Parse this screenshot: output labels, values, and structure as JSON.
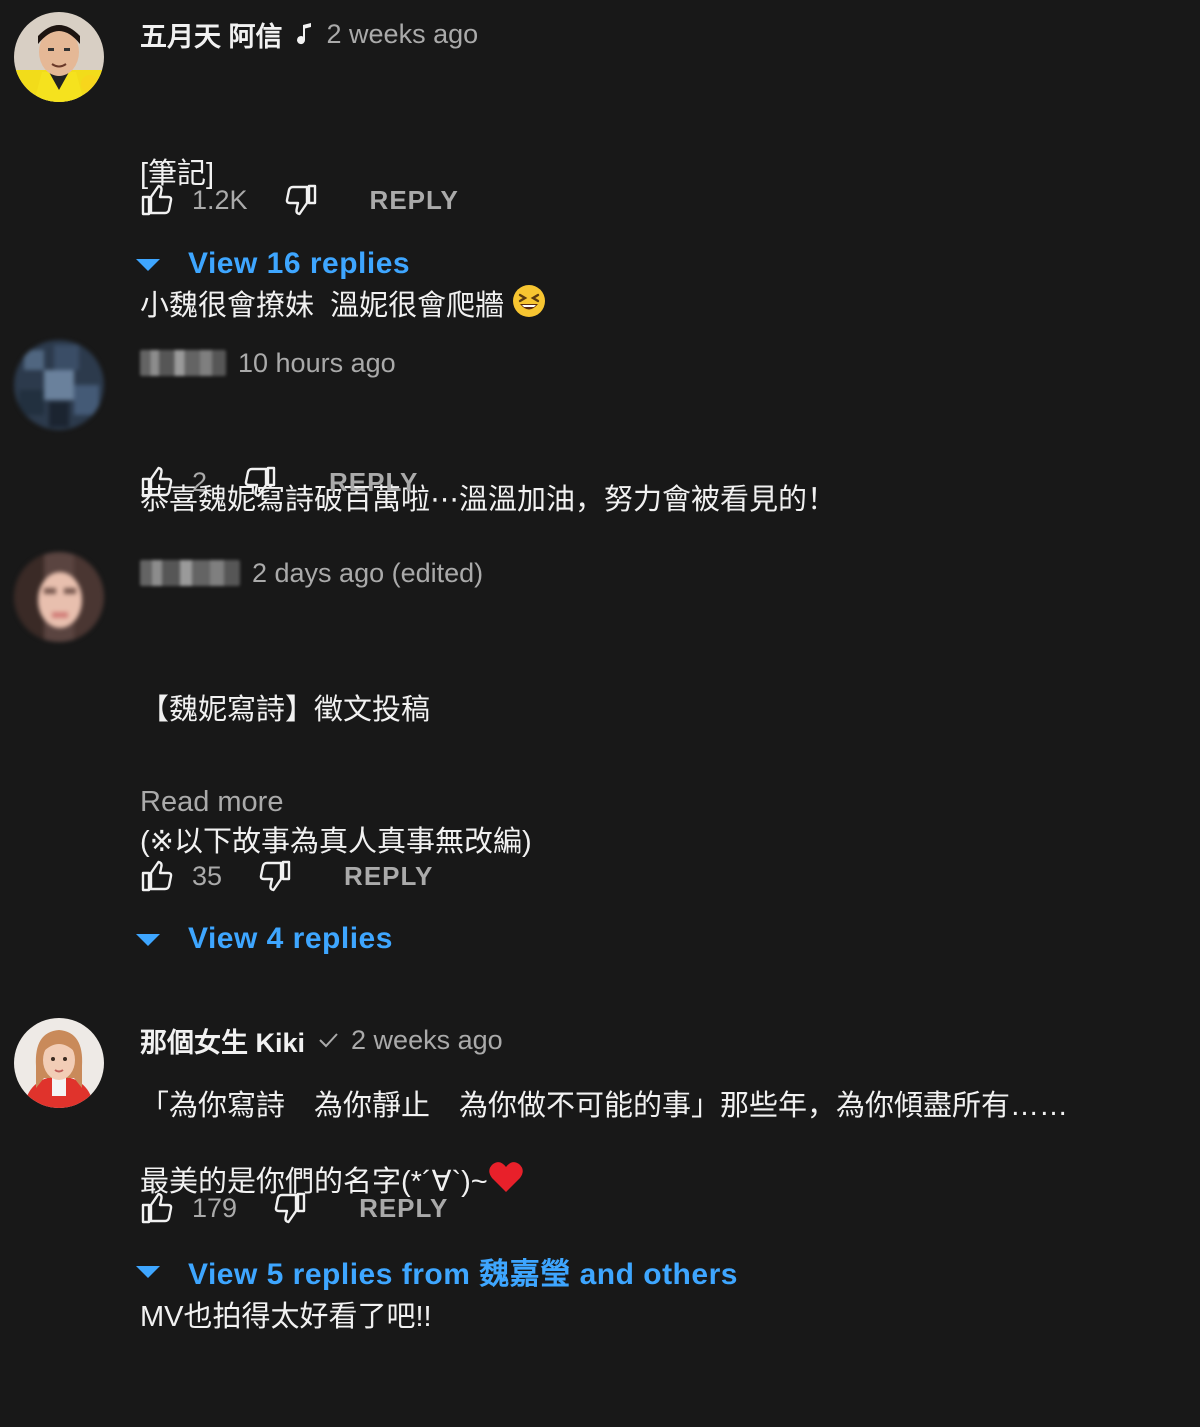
{
  "comments": [
    {
      "author": "五月天 阿信",
      "badge_icon": "music-note-icon",
      "timestamp": "2 weeks ago",
      "body_lines": [
        "[筆記]",
        "小魏很會撩妹  溫妮很會爬牆"
      ],
      "body_emoji": "grinning-squinting-face-emoji",
      "likes": "1.2K",
      "reply_label": "REPLY",
      "view_replies": "View 16 replies"
    },
    {
      "author_blurred": true,
      "timestamp": "10 hours ago",
      "body_lines": [
        "恭喜魏妮寫詩破百萬啦⋯溫溫加油，努力會被看見的！"
      ],
      "likes": "2",
      "reply_label": "REPLY"
    },
    {
      "author_blurred": true,
      "timestamp": "2 days ago (edited)",
      "body_lines": [
        "【魏妮寫詩】徵文投稿",
        "(※以下故事為真人真事無改編)",
        "",
        "「為你寫詩　為你靜止　為你做不可能的事」那些年，為你傾盡所有……"
      ],
      "read_more": "Read more",
      "likes": "35",
      "reply_label": "REPLY",
      "view_replies": "View 4 replies"
    },
    {
      "author": "那個女生 Kiki",
      "badge_icon": "verified-check-icon",
      "timestamp": "2 weeks ago",
      "body_lines": [
        "最美的是你們的名字(*´∀`)~",
        "MV也拍得太好看了吧!!"
      ],
      "body_emoji": "red-heart-emoji",
      "likes": "179",
      "reply_label": "REPLY",
      "view_replies": "View 5 replies from 魏嘉瑩 and others"
    }
  ],
  "colors": {
    "background": "#181818",
    "text": "#f1f1f1",
    "secondary": "#aaaaaa",
    "link": "#3ea6ff"
  }
}
